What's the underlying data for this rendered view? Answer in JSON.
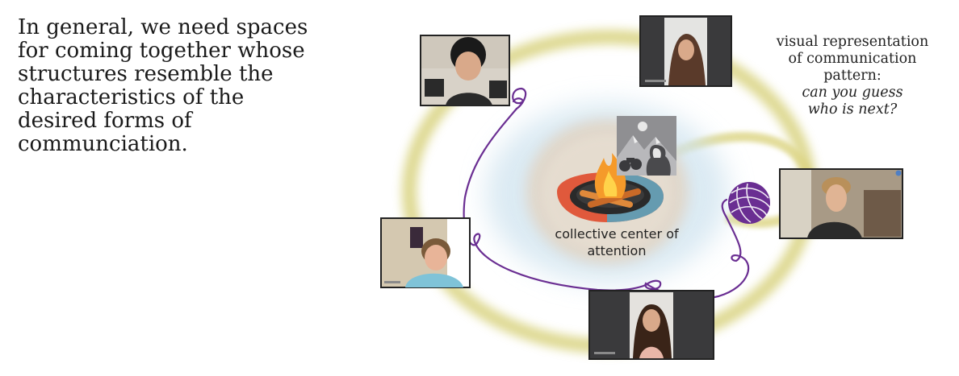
{
  "headline": {
    "lines": [
      "In general, we need spaces",
      "for coming together whose",
      "structures resemble the",
      "characteristics of the",
      "desired forms of",
      "communciation."
    ]
  },
  "caption": {
    "lines": [
      "visual representation",
      "of communication",
      "pattern:"
    ],
    "italic_lines": [
      "can you guess",
      "who is next?"
    ]
  },
  "center": {
    "label_lines": [
      "collective center of",
      "attention"
    ]
  },
  "participants": [
    {
      "id": "top-left"
    },
    {
      "id": "top-center"
    },
    {
      "id": "right"
    },
    {
      "id": "left"
    },
    {
      "id": "bottom"
    }
  ],
  "icons": [
    "campfire-icon",
    "yarn-ball-icon",
    "mountain-landscape-icon",
    "person-silhouette-icon",
    "binoculars-icon"
  ],
  "colors": {
    "ring": "#d8d27e",
    "halo": "#cfe3ef",
    "center": "#e0d6c8",
    "thread": "#6a2e92",
    "frame": "#222222",
    "fire": "#f59a2a"
  }
}
